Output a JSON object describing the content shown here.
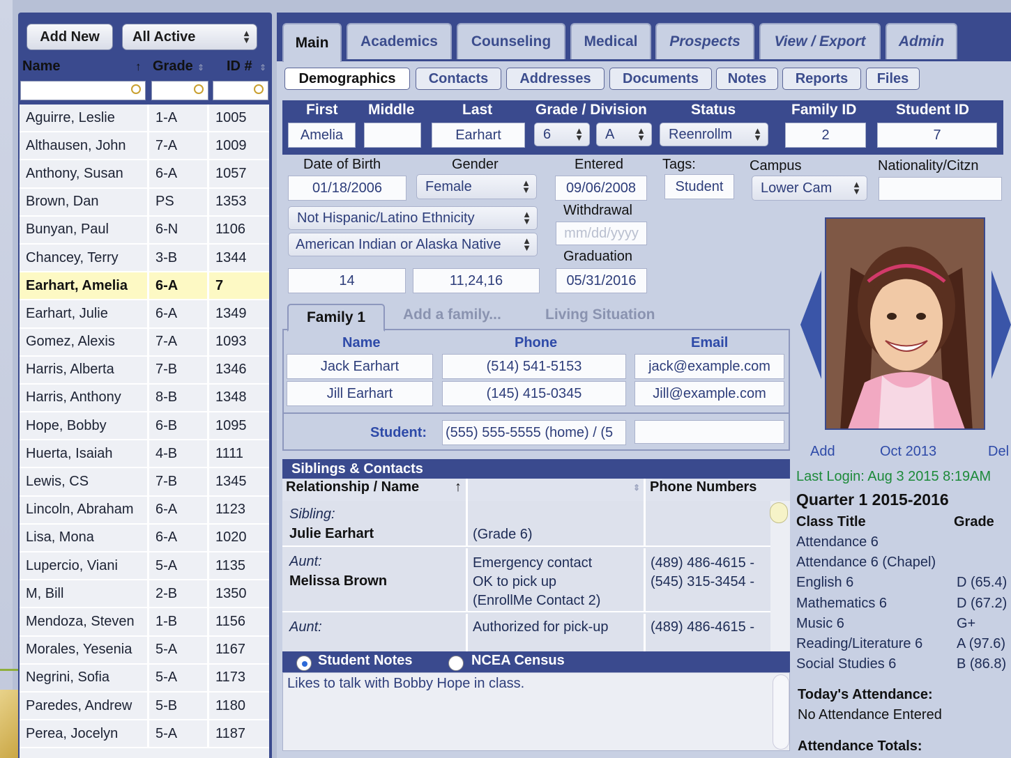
{
  "left_panel": {
    "add_new": "Add New",
    "filter_select": "All Active",
    "columns": [
      "Name",
      "Grade",
      "ID #"
    ],
    "students": [
      {
        "name": "Aguirre, Leslie",
        "grade": "1-A",
        "id": "1005"
      },
      {
        "name": "Althausen, John",
        "grade": "7-A",
        "id": "1009"
      },
      {
        "name": "Anthony, Susan",
        "grade": "6-A",
        "id": "1057"
      },
      {
        "name": "Brown, Dan",
        "grade": "PS",
        "id": "1353"
      },
      {
        "name": "Bunyan, Paul",
        "grade": "6-N",
        "id": "1106"
      },
      {
        "name": "Chancey, Terry",
        "grade": "3-B",
        "id": "1344"
      },
      {
        "name": "Earhart, Amelia",
        "grade": "6-A",
        "id": "7"
      },
      {
        "name": "Earhart, Julie",
        "grade": "6-A",
        "id": "1349"
      },
      {
        "name": "Gomez, Alexis",
        "grade": "7-A",
        "id": "1093"
      },
      {
        "name": "Harris, Alberta",
        "grade": "7-B",
        "id": "1346"
      },
      {
        "name": "Harris, Anthony",
        "grade": "8-B",
        "id": "1348"
      },
      {
        "name": "Hope, Bobby",
        "grade": "6-B",
        "id": "1095"
      },
      {
        "name": "Huerta, Isaiah",
        "grade": "4-B",
        "id": "1111"
      },
      {
        "name": "Lewis, CS",
        "grade": "7-B",
        "id": "1345"
      },
      {
        "name": "Lincoln, Abraham",
        "grade": "6-A",
        "id": "1123"
      },
      {
        "name": "Lisa, Mona",
        "grade": "6-A",
        "id": "1020"
      },
      {
        "name": "Lupercio, Viani",
        "grade": "5-A",
        "id": "1135"
      },
      {
        "name": "M, Bill",
        "grade": "2-B",
        "id": "1350"
      },
      {
        "name": "Mendoza, Steven",
        "grade": "1-B",
        "id": "1156"
      },
      {
        "name": "Morales, Yesenia",
        "grade": "5-A",
        "id": "1167"
      },
      {
        "name": "Negrini, Sofia",
        "grade": "5-A",
        "id": "1173"
      },
      {
        "name": "Paredes, Andrew",
        "grade": "5-B",
        "id": "1180"
      },
      {
        "name": "Perea, Jocelyn",
        "grade": "5-A",
        "id": "1187"
      }
    ],
    "selected_index": 6
  },
  "tabs": [
    "Main",
    "Academics",
    "Counseling",
    "Medical",
    "Prospects",
    "View / Export",
    "Admin"
  ],
  "subtabs": [
    "Demographics",
    "Contacts",
    "Addresses",
    "Documents",
    "Notes",
    "Reports",
    "Files"
  ],
  "demographics": {
    "headers": {
      "first": "First",
      "middle": "Middle",
      "last": "Last",
      "grade_division": "Grade / Division",
      "status": "Status",
      "family_id": "Family ID",
      "student_id": "Student ID"
    },
    "first": "Amelia",
    "middle": "",
    "last": "Earhart",
    "grade": "6",
    "division": "A",
    "status": "Reenrollm",
    "family_id": "2",
    "student_id": "7",
    "labels": {
      "dob": "Date of Birth",
      "gender": "Gender",
      "entered": "Entered",
      "tags": "Tags:",
      "campus": "Campus",
      "nationality": "Nationality/Citzn",
      "withdrawal": "Withdrawal",
      "graduation": "Graduation"
    },
    "dob": "01/18/2006",
    "gender": "Female",
    "entered": "09/06/2008",
    "tag": "Student",
    "campus": "Lower Cam",
    "ethnicity": "Not Hispanic/Latino Ethnicity",
    "race": "American Indian or Alaska Native",
    "withdrawal_placeholder": "mm/dd/yyyy",
    "graduation": "05/31/2016",
    "age": "14",
    "misc": "11,24,16"
  },
  "family": {
    "tab": "Family 1",
    "add": "Add a family...",
    "living": "Living Situation",
    "headers": [
      "Name",
      "Phone",
      "Email"
    ],
    "members": [
      {
        "name": "Jack Earhart",
        "phone": "(514) 541-5153",
        "email": "jack@example.com"
      },
      {
        "name": "Jill Earhart",
        "phone": "(145) 415-0345",
        "email": "Jill@example.com"
      }
    ],
    "student_label": "Student:",
    "student_phone": "(555) 555-5555 (home) / (5"
  },
  "siblings": {
    "title": "Siblings & Contacts",
    "col1": "Relationship / Name",
    "col3": "Phone Numbers",
    "rows": [
      {
        "rel": "Sibling:",
        "name": "Julie Earhart",
        "info": "(Grade 6)",
        "phones": ""
      },
      {
        "rel": "Aunt:",
        "name": "Melissa Brown",
        "info": "Emergency contact\nOK to pick up\n(EnrollMe Contact 2)",
        "phones": "(489) 486-4615 -\n(545) 315-3454 -"
      },
      {
        "rel": "Aunt:",
        "name": "",
        "info": "Authorized for pick-up",
        "phones": "(489) 486-4615 -"
      }
    ]
  },
  "notes": {
    "opt1": "Student Notes",
    "opt2": "NCEA Census",
    "text": "Likes to talk with Bobby Hope in class."
  },
  "photo_panel": {
    "add": "Add",
    "date": "Oct 2013",
    "del": "Del",
    "last_login": "Last Login: Aug 3 2015 8:19AM"
  },
  "grades": {
    "quarter": "Quarter 1 2015-2016",
    "col1": "Class Title",
    "col2": "Grade",
    "classes": [
      {
        "title": "Attendance 6",
        "grade": ""
      },
      {
        "title": "Attendance 6 (Chapel)",
        "grade": ""
      },
      {
        "title": "English 6",
        "grade": "D (65.4)"
      },
      {
        "title": "Mathematics 6",
        "grade": "D (67.2)"
      },
      {
        "title": "Music 6",
        "grade": "G+"
      },
      {
        "title": "Reading/Literature 6",
        "grade": "A (97.6)"
      },
      {
        "title": "Social Studies 6",
        "grade": "B (86.8)"
      }
    ],
    "today_label": "Today's Attendance:",
    "today_value": "No Attendance Entered",
    "totals_label": "Attendance Totals:"
  }
}
